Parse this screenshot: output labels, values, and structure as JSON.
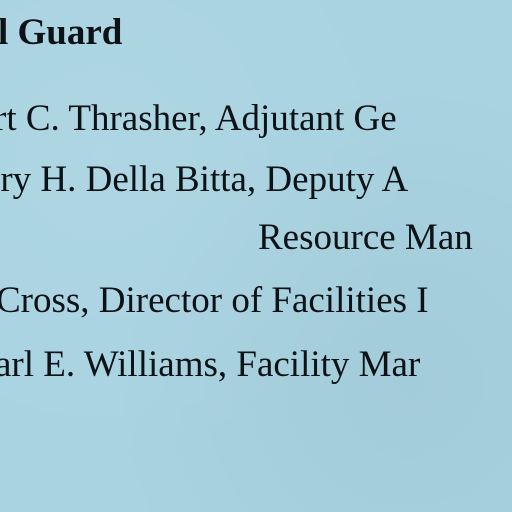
{
  "document": {
    "heading": "l Guard",
    "lines": [
      "rt C. Thrasher, Adjutant Ge",
      "rry H. Della Bitta, Deputy A",
      "Resource Man",
      "Cross, Director of Facilities I",
      "arl E. Williams, Facility Mar"
    ]
  },
  "colors": {
    "paper": "#a9d3e1",
    "ink": "#0c1216"
  }
}
